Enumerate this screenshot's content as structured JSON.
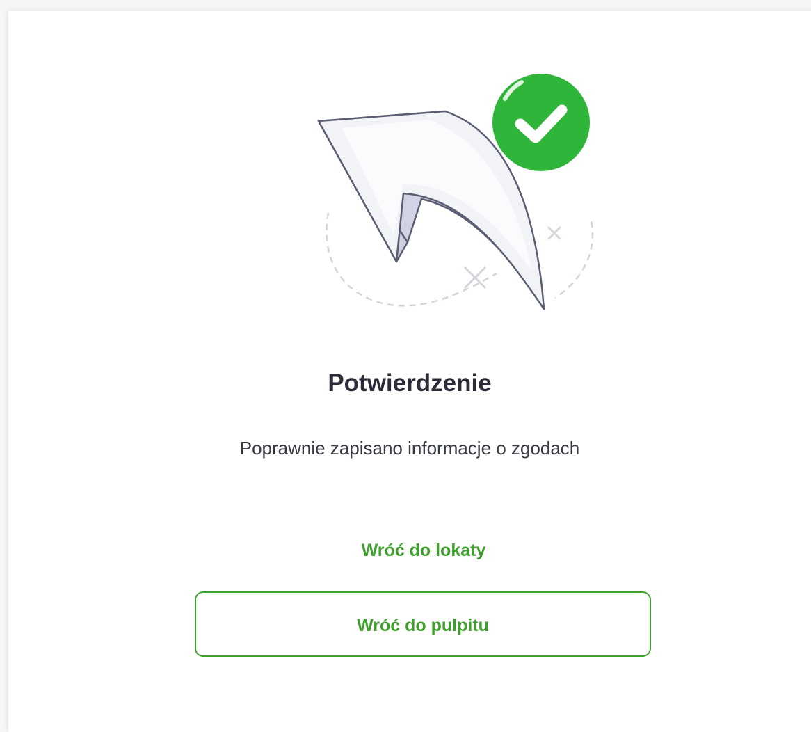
{
  "confirmation": {
    "title": "Potwierdzenie",
    "message": "Poprawnie zapisano informacje o zgodach"
  },
  "actions": {
    "back_to_deposit_label": "Wróć do lokaty",
    "back_to_dashboard_label": "Wróć do pulpitu"
  },
  "illustration": {
    "icon": "return-arrow-with-check-icon",
    "check_icon": "checkmark-circle-icon"
  },
  "colors": {
    "accent": "#3e9f2c",
    "check_circle": "#2fb53a",
    "title": "#2b2b3a",
    "text": "#363842"
  }
}
